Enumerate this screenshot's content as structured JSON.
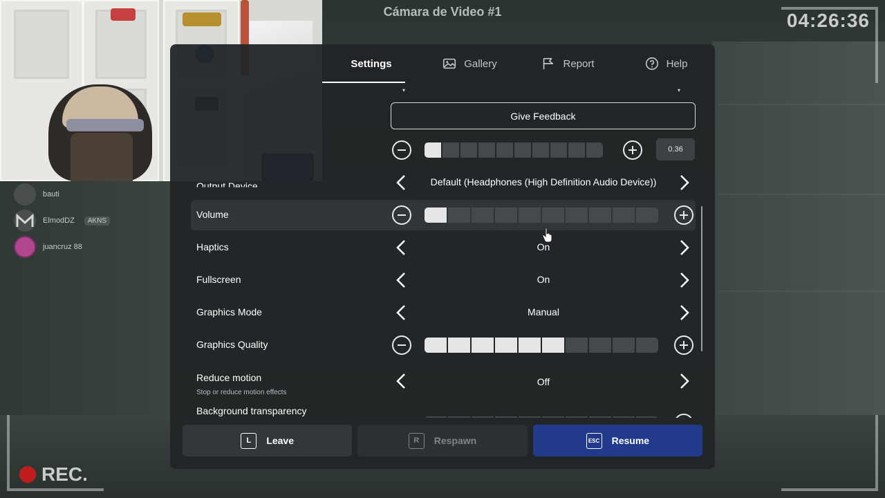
{
  "overlay": {
    "camera_title": "Cámara de Video #1",
    "clock": "04:26:36",
    "rec_label": "REC."
  },
  "players": [
    {
      "name": "bauti",
      "tag": "",
      "avatar": "dark-avatar"
    },
    {
      "name": "ElmodDZ",
      "tag": "AKNS",
      "avatar": "m-logo-avatar"
    },
    {
      "name": "juancruz 88",
      "tag": "",
      "avatar": "pink-character-avatar"
    }
  ],
  "tabs": [
    {
      "label": "Settings",
      "icon": "none",
      "active": true
    },
    {
      "label": "Gallery",
      "icon": "image-icon",
      "active": false
    },
    {
      "label": "Report",
      "icon": "flag-icon",
      "active": false
    },
    {
      "label": "Help",
      "icon": "help-circle-icon",
      "active": false
    }
  ],
  "settings": {
    "feedback_label": "Give Feedback",
    "top_slider": {
      "value_display": "0.36",
      "filled_segments": 1,
      "total_segments": 10
    },
    "output_device": {
      "label": "Output Device",
      "value": "Default (Headphones (High Definition Audio Device))"
    },
    "volume": {
      "label": "Volume",
      "filled_segments": 1,
      "total_segments": 10
    },
    "haptics": {
      "label": "Haptics",
      "value": "On"
    },
    "fullscreen": {
      "label": "Fullscreen",
      "value": "On"
    },
    "graphics_mode": {
      "label": "Graphics Mode",
      "value": "Manual"
    },
    "graphics_quality": {
      "label": "Graphics Quality",
      "filled_segments": 6,
      "total_segments": 10
    },
    "reduce_motion": {
      "label": "Reduce motion",
      "sublabel": "Stop or reduce motion effects",
      "value": "Off"
    },
    "background_transparency": {
      "label": "Background transparency",
      "filled_segments": 0,
      "total_segments": 10
    }
  },
  "footer": {
    "leave": {
      "label": "Leave",
      "key": "L"
    },
    "respawn": {
      "label": "Respawn",
      "key": "R"
    },
    "resume": {
      "label": "Resume",
      "key": "ESC"
    }
  },
  "colors": {
    "resume_button": "#213a8c",
    "rec_dot": "#c21d1d",
    "segment_on": "#e6e6e6",
    "segment_off": "#45494c"
  }
}
